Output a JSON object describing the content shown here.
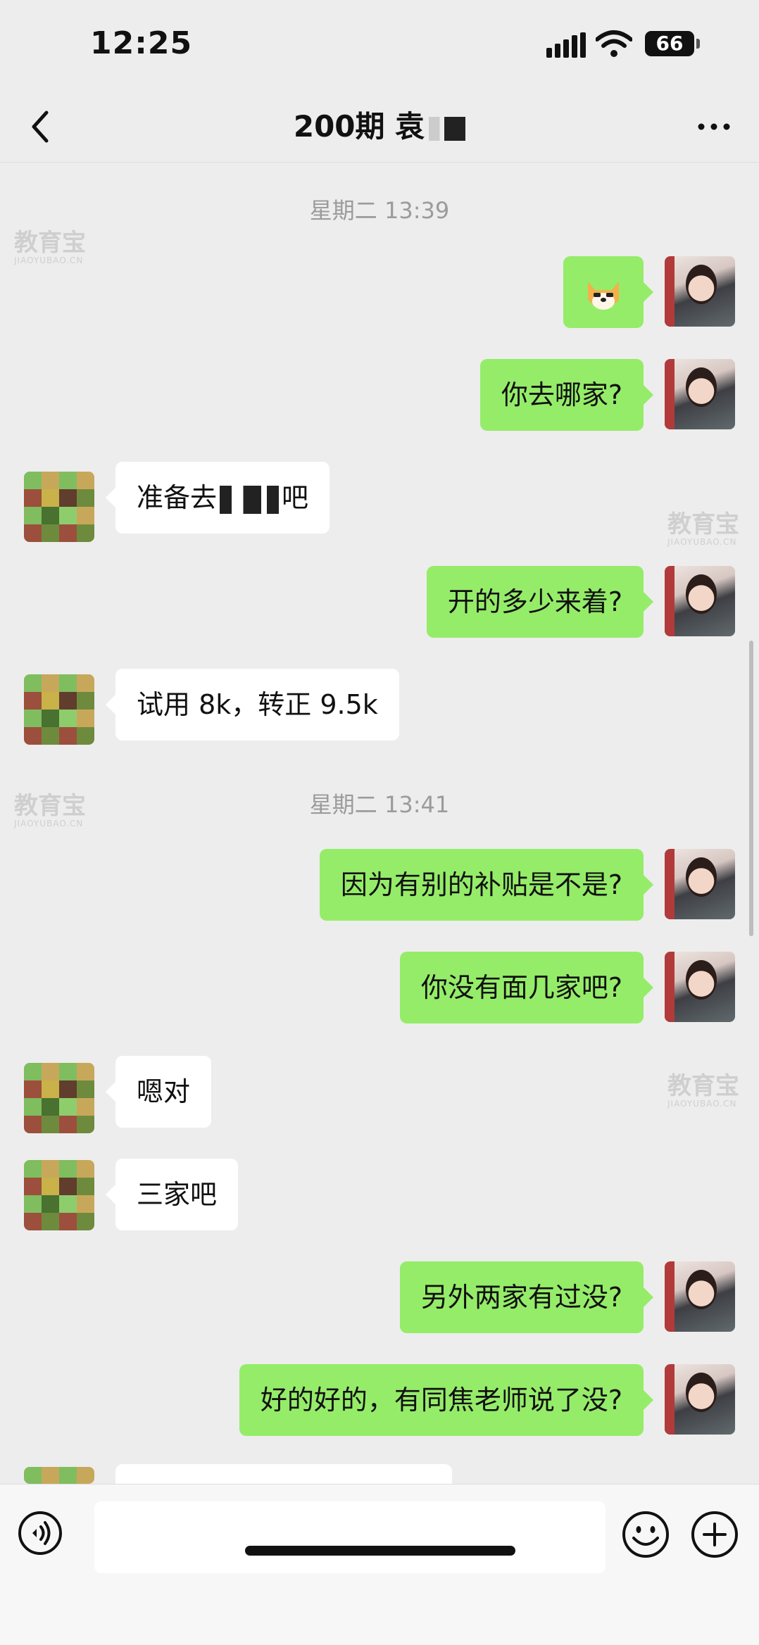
{
  "status_bar": {
    "time": "12:25",
    "battery": "66"
  },
  "header": {
    "title": "200期 袁"
  },
  "timestamps": [
    "星期二 13:39",
    "星期二 13:41"
  ],
  "messages": [
    {
      "side": "out",
      "type": "emoji",
      "icon": "shiba-dog-emoji"
    },
    {
      "side": "out",
      "text": "你去哪家?"
    },
    {
      "side": "in",
      "text_before": "准备去",
      "text_after": "吧"
    },
    {
      "side": "out",
      "text": "开的多少来着?"
    },
    {
      "side": "in",
      "text": "试用 8k，转正 9.5k"
    },
    {
      "side": "out",
      "text": "因为有别的补贴是不是?"
    },
    {
      "side": "out",
      "text": "你没有面几家吧?"
    },
    {
      "side": "in",
      "text": "嗯对"
    },
    {
      "side": "in",
      "text": "三家吧"
    },
    {
      "side": "out",
      "text": "另外两家有过没?"
    },
    {
      "side": "out",
      "text": "好的好的，有同焦老师说了没?"
    }
  ],
  "watermark": {
    "cn": "教育宝",
    "en": "JIAOYUBAO.CN"
  },
  "colors": {
    "outgoing_bubble": "#95ec69",
    "incoming_bubble": "#ffffff",
    "background": "#ededed"
  },
  "icons": [
    "back-icon",
    "more-icon",
    "voice-icon",
    "emoji-icon",
    "plus-icon"
  ]
}
